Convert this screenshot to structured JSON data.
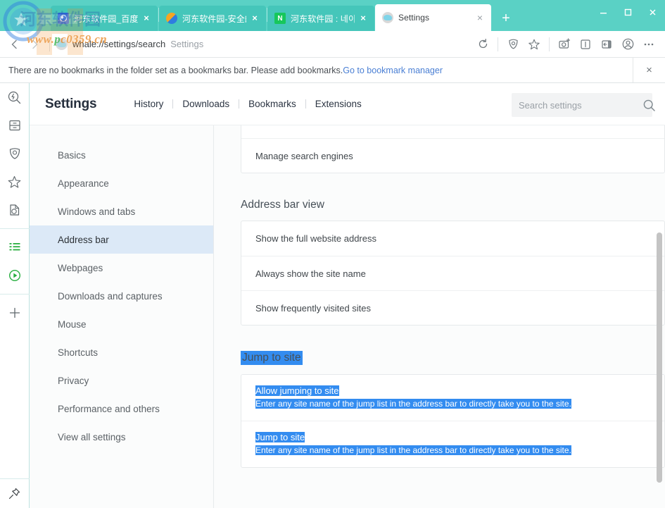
{
  "window": {
    "controls": {
      "minimize": "minimize-icon",
      "maximize": "maximize-icon",
      "close": "close-icon"
    },
    "accent_teal": "#5ad1c5",
    "tab_inactive": "#45c6ba"
  },
  "tabs": [
    {
      "title": "河东软件园_百度搜索",
      "favicon": "baidu-icon",
      "active": false,
      "close": "×"
    },
    {
      "title": "河东软件园-安全的绿",
      "favicon": "hedong-icon",
      "active": false,
      "close": "×"
    },
    {
      "title": "河东软件园 : 네이버",
      "favicon": "naver-icon",
      "active": false,
      "close": "×"
    },
    {
      "title": "Settings",
      "favicon": "whale-icon",
      "active": true,
      "close": "×"
    }
  ],
  "new_tab_label": "+",
  "omnibox": {
    "url": "whale://settings/search",
    "page_label": "Settings",
    "back_icon": "back-arrow-icon",
    "forward_icon": "forward-arrow-icon",
    "reload_icon": "reload-icon",
    "shield_icon": "whale-shield-icon",
    "bookmark_icon": "star-icon",
    "capture_icon": "camera-capture-icon",
    "reader_icon": "reader-mode-icon",
    "sidebar_icon": "sidebar-toggle-icon",
    "profile_icon": "account-icon",
    "more_icon": "more-options-icon"
  },
  "bookmark_notice": {
    "text": "There are no bookmarks in the folder set as a bookmarks bar. Please add bookmarks.",
    "link": "Go to bookmark manager",
    "close": "×"
  },
  "leftbar": {
    "items": [
      {
        "name": "quick-search-icon"
      },
      {
        "name": "drawer-icon"
      },
      {
        "name": "whale-shield-icon"
      },
      {
        "name": "favorites-star-icon"
      },
      {
        "name": "translate-note-icon"
      },
      {
        "name": "green-list-icon"
      },
      {
        "name": "green-play-icon"
      },
      {
        "name": "add-panel-icon"
      }
    ],
    "pin_icon": "pin-icon"
  },
  "settings": {
    "title": "Settings",
    "nav": [
      "History",
      "Downloads",
      "Bookmarks",
      "Extensions"
    ],
    "search": {
      "placeholder": "Search settings",
      "value": "",
      "icon": "search-icon"
    },
    "menu": [
      {
        "label": "Basics",
        "selected": false
      },
      {
        "label": "Appearance",
        "selected": false
      },
      {
        "label": "Windows and tabs",
        "selected": false
      },
      {
        "label": "Address bar",
        "selected": true
      },
      {
        "label": "Webpages",
        "selected": false
      },
      {
        "label": "Downloads and captures",
        "selected": false
      },
      {
        "label": "Mouse",
        "selected": false
      },
      {
        "label": "Shortcuts",
        "selected": false
      },
      {
        "label": "Privacy",
        "selected": false
      },
      {
        "label": "Performance and others",
        "selected": false
      },
      {
        "label": "View all settings",
        "selected": false
      }
    ],
    "selection_color": "#338cf0",
    "sections": [
      {
        "heading": "",
        "heading_selected": false,
        "rows": [
          {
            "title": "Manage search engines",
            "desc": "",
            "selected": false
          }
        ]
      },
      {
        "heading": "Address bar view",
        "heading_selected": false,
        "rows": [
          {
            "title": "Show the full website address",
            "desc": "",
            "selected": false
          },
          {
            "title": "Always show the site name",
            "desc": "",
            "selected": false
          },
          {
            "title": "Show frequently visited sites",
            "desc": "",
            "selected": false
          }
        ]
      },
      {
        "heading": "Jump to site",
        "heading_selected": true,
        "rows": [
          {
            "title": "Allow jumping to site",
            "desc": "Enter any site name of the jump list in the address bar to directly take you to the site.",
            "selected": true
          },
          {
            "title": "Jump to site",
            "desc": "Enter any site name of the jump list in the address bar to directly take you to the site.",
            "selected": true
          }
        ]
      }
    ]
  },
  "watermark": {
    "url_prefix": "www.",
    "url_green": "p",
    "url_rest": "c0359.cn",
    "chinese": "河东软件园"
  }
}
